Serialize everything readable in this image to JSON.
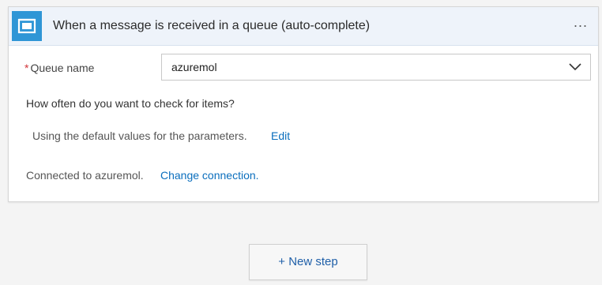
{
  "trigger": {
    "title": "When a message is received in a queue (auto-complete)",
    "icon": "service-bus-queue-icon",
    "more_label": "..."
  },
  "queue_field": {
    "required_mark": "*",
    "label": "Queue name",
    "value": "azuremol"
  },
  "schedule": {
    "question": "How often do you want to check for items?",
    "defaults_text": "Using the default values for the parameters.",
    "edit_label": "Edit"
  },
  "connection": {
    "text": "Connected to azuremol.",
    "change_label": "Change connection."
  },
  "new_step": {
    "label": "+ New step"
  },
  "colors": {
    "accent": "#2f96d6",
    "link": "#0a6ebd",
    "required": "#d13438",
    "header_bg": "#eef3fa"
  }
}
